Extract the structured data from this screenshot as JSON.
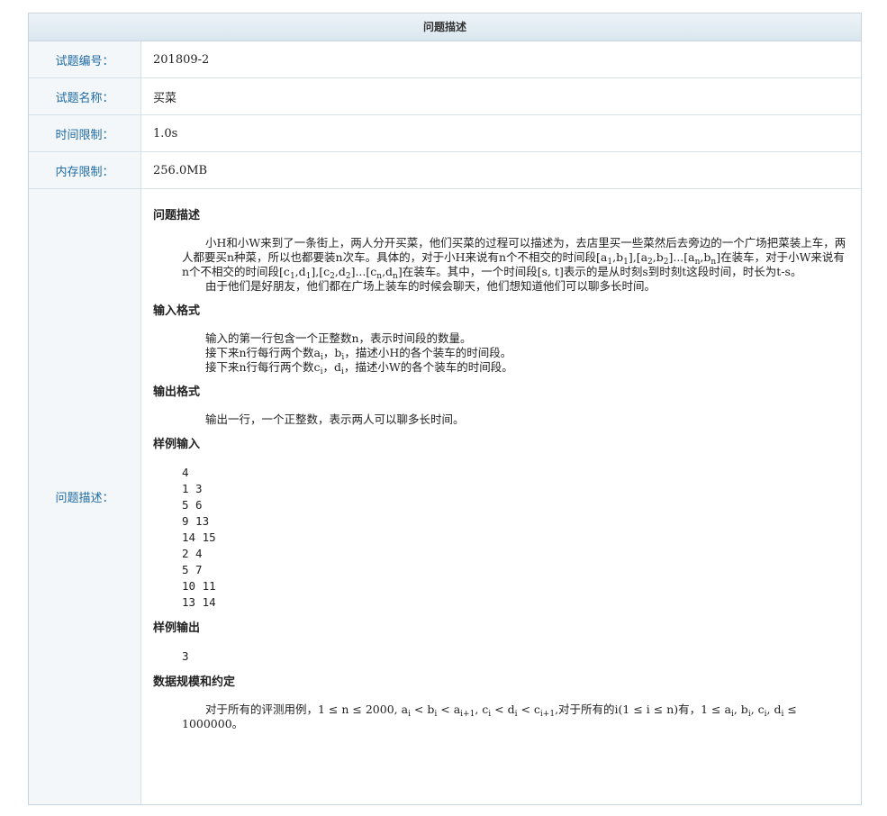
{
  "header": {
    "title": "问题描述"
  },
  "rows": {
    "id_label": "试题编号：",
    "id_value": "201809-2",
    "name_label": "试题名称：",
    "name_value": "买菜",
    "time_label": "时间限制：",
    "time_value": "1.0s",
    "mem_label": "内存限制：",
    "mem_value": "256.0MB",
    "desc_label": "问题描述："
  },
  "desc": {
    "h_problem": "问题描述",
    "p1_a": "小H和小W来到了一条街上，两人分开买菜，他们买菜的过程可以描述为，去店里买一些菜然后去旁边的一个广场把菜装上车，两人都要买n种菜，所以也都要装n次车。具体的，对于小H来说有n个不相交的时间段[a",
    "p1_b": ",b",
    "p1_c": "],[a",
    "p1_d": ",b",
    "p1_e": "]...[a",
    "p1_f": ",b",
    "p1_g": "]在装车，对于小W来说有n个不相交的时间段[c",
    "p1_h": ",d",
    "p1_i": "],[c",
    "p1_j": ",d",
    "p1_k": "]...[c",
    "p1_l": ",d",
    "p1_m": "]在装车。其中，一个时间段[s, t]表示的是从时刻s到时刻t这段时间，时长为t-s。",
    "p2": "由于他们是好朋友，他们都在广场上装车的时候会聊天，他们想知道他们可以聊多长时间。",
    "h_input": "输入格式",
    "in1": "输入的第一行包含一个正整数n，表示时间段的数量。",
    "in2_a": "接下来n行每行两个数a",
    "in2_b": "，b",
    "in2_c": "，描述小H的各个装车的时间段。",
    "in3_a": "接下来n行每行两个数c",
    "in3_b": "，d",
    "in3_c": "，描述小W的各个装车的时间段。",
    "h_output": "输出格式",
    "out1": "输出一行，一个正整数，表示两人可以聊多长时间。",
    "h_sample_in": "样例输入",
    "sample_in": "4\n1 3\n5 6\n9 13\n14 15\n2 4\n5 7\n10 11\n13 14",
    "h_sample_out": "样例输出",
    "sample_out": "3",
    "h_scale": "数据规模和约定",
    "sc_a": "对于所有的评测用例，1 ≤ n ≤ 2000, a",
    "sc_b": " < b",
    "sc_c": " < a",
    "sc_d": ", c",
    "sc_e": " < d",
    "sc_f": " < c",
    "sc_g": ",对于所有的i(1 ≤ i ≤ n)有，1 ≤ a",
    "sc_h": ", b",
    "sc_i": ", c",
    "sc_j": ", d",
    "sc_k": " ≤ 1000000。",
    "sub_1": "1",
    "sub_2": "2",
    "sub_n": "n",
    "sub_i": "i",
    "sub_i1": "i+1"
  }
}
